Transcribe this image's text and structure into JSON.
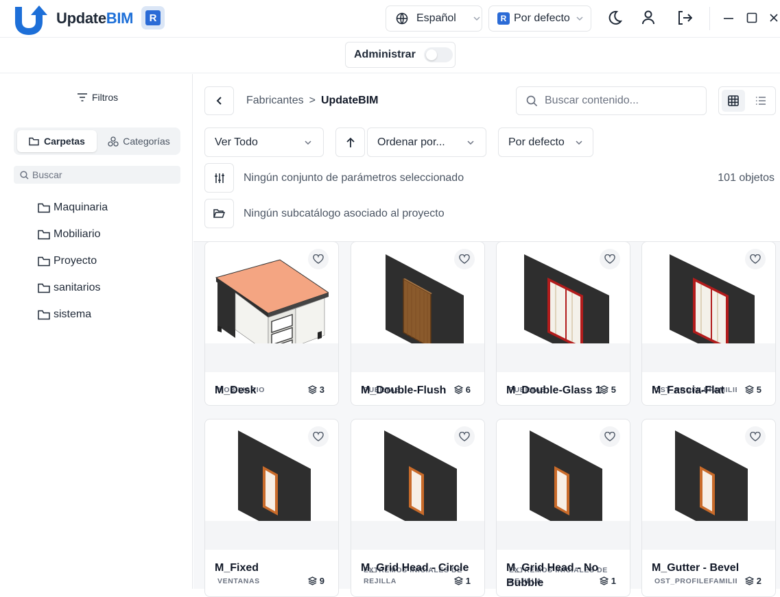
{
  "app": {
    "name_part1": "Update",
    "name_part2": "BIM",
    "badge": "R"
  },
  "header": {
    "language": "Español",
    "profile_badge": "R",
    "profile": "Por defecto"
  },
  "admin": {
    "label": "Administrar",
    "enabled": false
  },
  "sidebar": {
    "filters_label": "Filtros",
    "tabs": [
      {
        "label": "Carpetas",
        "active": true
      },
      {
        "label": "Categorías",
        "active": false
      }
    ],
    "search_placeholder": "Buscar",
    "folders": [
      "Maquinaria",
      "Mobiliario",
      "Proyecto",
      "sanitarios",
      "sistema"
    ]
  },
  "breadcrumb": {
    "parent": "Fabricantes",
    "separator": ">",
    "current": "UpdateBIM"
  },
  "search": {
    "placeholder": "Buscar contenido..."
  },
  "filters": {
    "view": "Ver Todo",
    "sort": "Ordenar por...",
    "profile": "Por defecto"
  },
  "params_info": "Ningún conjunto de parámetros seleccionado",
  "object_count": "101 objetos",
  "subcatalog_info": "Ningún subcatálogo asociado al proyecto",
  "items": [
    {
      "name": "M_Desk",
      "category": "MOBILIARIO",
      "count": "3",
      "icon": "desk"
    },
    {
      "name": "M_Double-Flush",
      "category": "PUERTAS",
      "count": "6",
      "icon": "door"
    },
    {
      "name": "M_Double-Glass 1",
      "category": "PUERTAS",
      "count": "5",
      "icon": "glass-door"
    },
    {
      "name": "M_Fascia-Flat",
      "category": "OST_PROFILEFAMILIES",
      "count": "5",
      "icon": "glass-door"
    },
    {
      "name": "M_Fixed",
      "category": "VENTANAS",
      "count": "9",
      "icon": "window"
    },
    {
      "name": "M_Grid Head - Circle",
      "category": "EXTREMOS INICIALES DE REJILLA",
      "count": "1",
      "icon": "window"
    },
    {
      "name": "M_Grid Head - No Bubble",
      "category": "EXTREMOS INICIALES DE REJILLA",
      "count": "1",
      "icon": "window"
    },
    {
      "name": "M_Gutter - Bevel",
      "category": "OST_PROFILEFAMILIES",
      "count": "2",
      "icon": "window"
    }
  ],
  "colors": {
    "accent": "#1d6fd8",
    "brand_dark": "#1f2937",
    "wall": "#2e2e2e",
    "frame_red": "#b21c1c",
    "desk_top": "#f4a582"
  }
}
